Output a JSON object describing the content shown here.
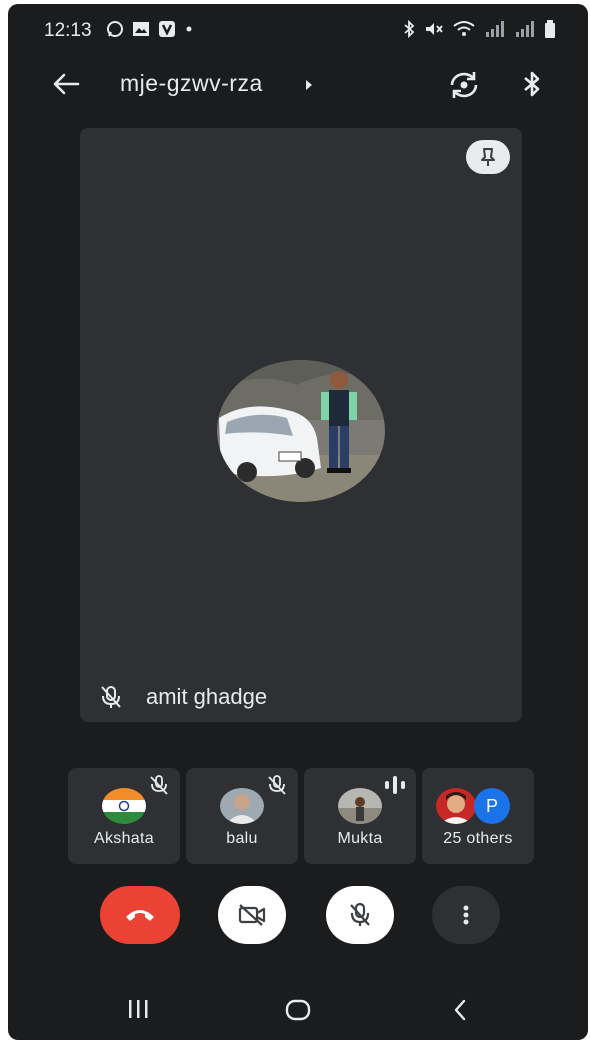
{
  "status_bar": {
    "time": "12:13",
    "left_icons": [
      "whatsapp-icon",
      "gallery-icon",
      "v-app-icon",
      "dot-icon"
    ],
    "right_icons": [
      "bluetooth-icon",
      "mute-icon",
      "wifi-icon",
      "signal-icon",
      "signal-icon",
      "battery-icon"
    ]
  },
  "header": {
    "meeting_code": "mje-gzwv-rza"
  },
  "main_speaker": {
    "name": "amit ghadge",
    "muted": true
  },
  "participants": [
    {
      "name": "Akshata",
      "state": "muted"
    },
    {
      "name": "balu",
      "state": "muted"
    },
    {
      "name": "Mukta",
      "state": "speaking"
    },
    {
      "name": "25 others",
      "extra_avatar_letter": "P"
    }
  ],
  "controls": [
    "end-call",
    "camera-off",
    "mic-off",
    "more-options"
  ],
  "colors": {
    "background": "#1b1c1e",
    "tile": "#2e3033",
    "end_call": "#ea4335",
    "avatar_p": "#1a73e8",
    "text": "#e8eaed"
  }
}
